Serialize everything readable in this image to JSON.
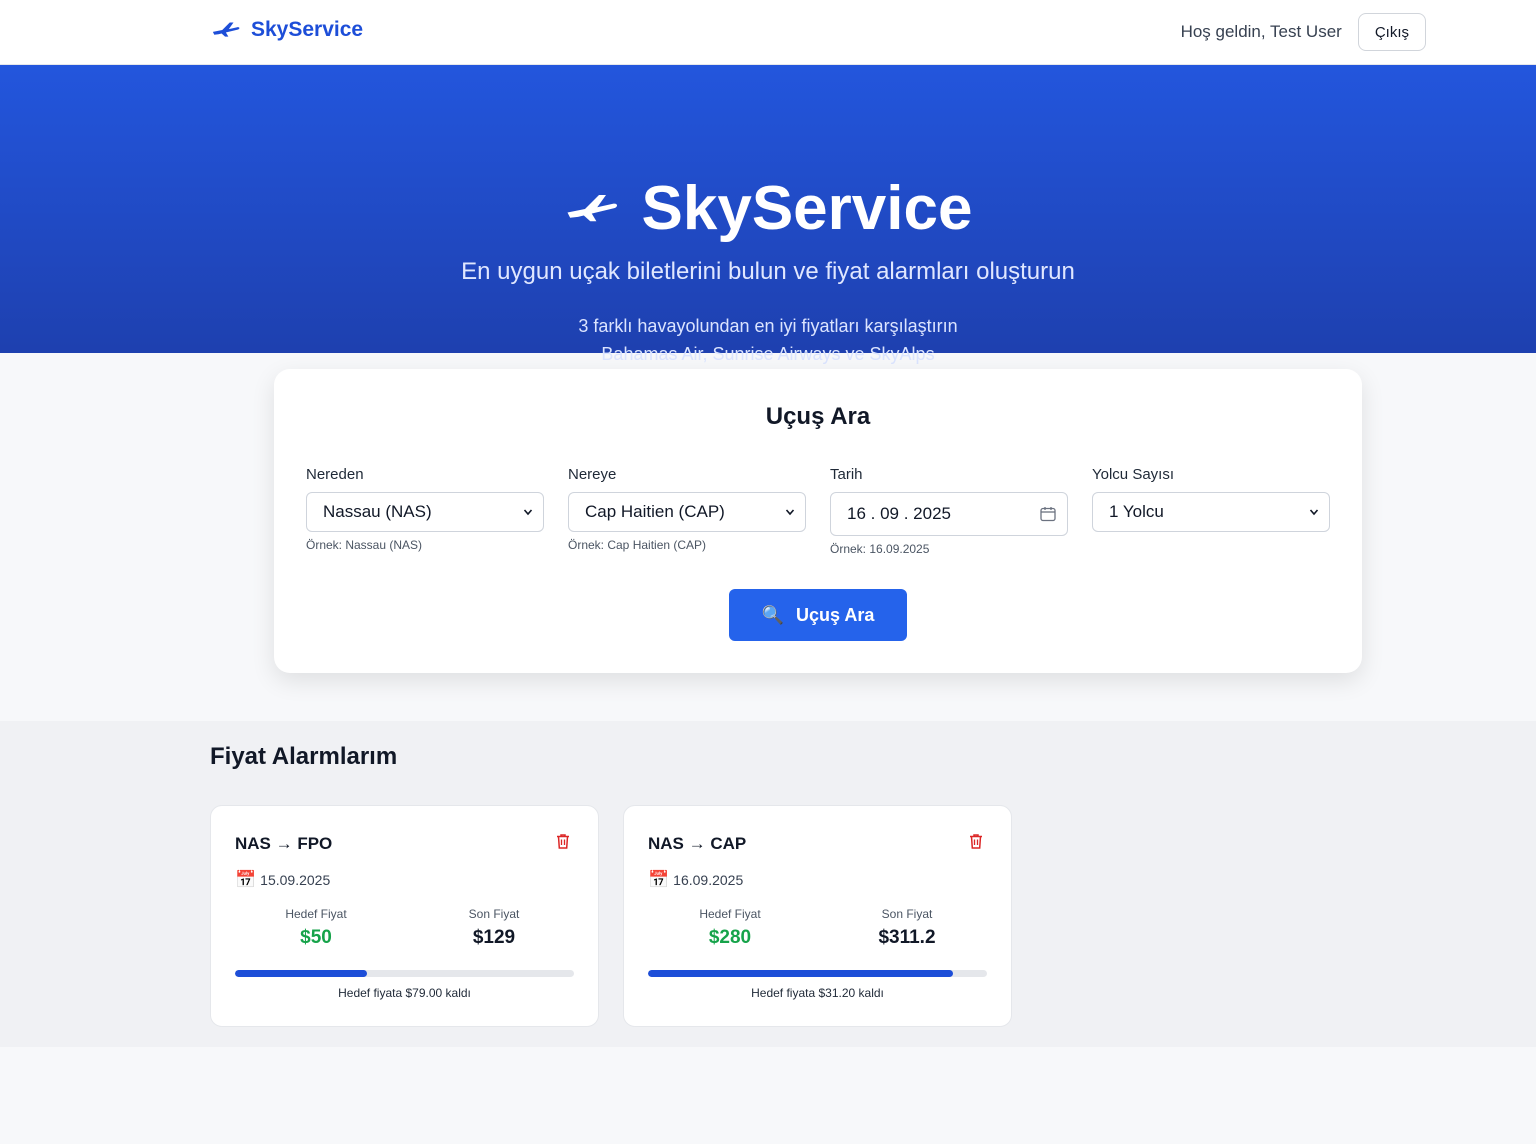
{
  "header": {
    "brand": "SkyService",
    "welcome": "Hoş geldin, Test User",
    "logout_label": "Çıkış"
  },
  "hero": {
    "title": "SkyService",
    "subtitle": "En uygun uçak biletlerini bulun ve fiyat alarmları oluşturun",
    "line1": "3 farklı havayolundan en iyi fiyatları karşılaştırın",
    "line2": "Bahamas Air, Sunrise Airways ve SkyAlps"
  },
  "search": {
    "title": "Uçuş Ara",
    "from": {
      "label": "Nereden",
      "value": "Nassau (NAS)",
      "hint": "Örnek: Nassau (NAS)"
    },
    "to": {
      "label": "Nereye",
      "value": "Cap Haitien (CAP)",
      "hint": "Örnek: Cap Haitien (CAP)"
    },
    "date": {
      "label": "Tarih",
      "value": "16 . 09 . 2025",
      "hint": "Örnek: 16.09.2025"
    },
    "passengers": {
      "label": "Yolcu Sayısı",
      "value": "1 Yolcu"
    },
    "button_label": "Uçuş Ara",
    "button_icon": "🔍"
  },
  "alarms": {
    "title": "Fiyat Alarmlarım",
    "items": [
      {
        "route": "NAS → FPO",
        "date": "15.09.2025",
        "target_label": "Hedef Fiyat",
        "target_price": "$50",
        "last_label": "Son Fiyat",
        "last_price": "$129",
        "progress": 0.39,
        "remaining": "Hedef fiyata $79.00 kaldı"
      },
      {
        "route": "NAS → CAP",
        "date": "16.09.2025",
        "target_label": "Hedef Fiyat",
        "target_price": "$280",
        "last_label": "Son Fiyat",
        "last_price": "$311.2",
        "progress": 0.9,
        "remaining": "Hedef fiyata $31.20 kaldı"
      }
    ]
  },
  "colors": {
    "brand": "#1d4ed8",
    "primary_button": "#2563eb",
    "target_price": "#16a34a",
    "delete_icon": "#dc2626"
  },
  "icons": {
    "brand": "airplane-icon",
    "date_picker": "calendar-icon",
    "delete": "trash-icon",
    "alarm_date": "calendar-emoji-icon",
    "search": "magnifier-icon"
  }
}
